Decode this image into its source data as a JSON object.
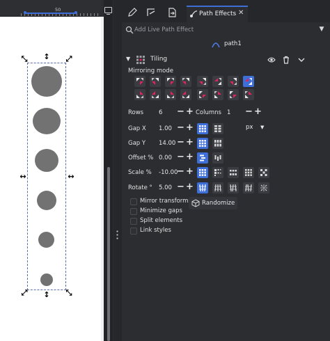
{
  "ruler": {
    "label": "50"
  },
  "tabs": [
    {
      "name": "edit-icon"
    },
    {
      "name": "snap-icon"
    },
    {
      "name": "export-icon"
    },
    {
      "label": "Path Effects",
      "icon": "path-effects-icon",
      "active": true
    }
  ],
  "lpe": {
    "search_placeholder": "Add Live Path Effect",
    "path_name": "path1",
    "effect_name": "Tiling"
  },
  "tiling": {
    "mirroring_label": "Mirroring mode",
    "rows_label": "Rows",
    "rows": "6",
    "columns_label": "Columns",
    "columns": "1",
    "gapx_label": "Gap X",
    "gapx": "1.00",
    "gapy_label": "Gap Y",
    "gapy": "14.00",
    "unit": "px",
    "offset_label": "Offset %",
    "offset": "0.00",
    "scale_label": "Scale %",
    "scale": "-10.00",
    "rotate_label": "Rotate °",
    "rotate": "5.00",
    "checkboxes": [
      "Mirror transforms",
      "Minimize gaps",
      "Split elements",
      "Link styles"
    ],
    "randomize_label": "Randomize"
  },
  "colors": {
    "accent": "#3e6fd8",
    "mirror_red": "#e0245e",
    "canvas": "#ffffff",
    "circle": "#727272"
  }
}
